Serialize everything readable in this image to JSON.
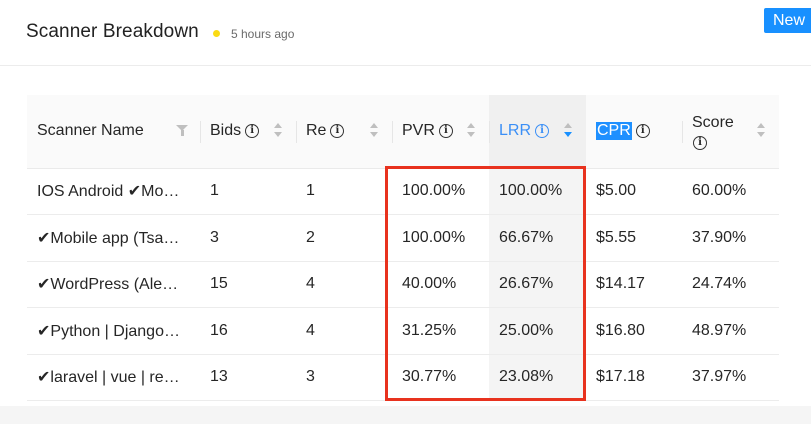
{
  "header": {
    "title": "Scanner Breakdown",
    "timestamp": "5 hours ago",
    "new_button": "New",
    "status_dot_color": "#fadb14"
  },
  "table": {
    "columns": [
      {
        "key": "name",
        "label": "Scanner Name",
        "icon": "filter-icon"
      },
      {
        "key": "bids",
        "label": "Bids",
        "info": true,
        "sort": "none"
      },
      {
        "key": "re",
        "label": "Re",
        "info": true,
        "sort": "none"
      },
      {
        "key": "pvr",
        "label": "PVR",
        "info": true,
        "sort": "none"
      },
      {
        "key": "lrr",
        "label": "LRR",
        "info": true,
        "sort": "descending",
        "active": true
      },
      {
        "key": "cpr",
        "label": "CPR",
        "info": true,
        "selected_text": true
      },
      {
        "key": "score",
        "label": "Score",
        "info": true,
        "sort": "none"
      }
    ],
    "rows": [
      {
        "name": "IOS Android ✔Mo…",
        "bids": "1",
        "re": "1",
        "pvr": "100.00%",
        "lrr": "100.00%",
        "cpr": "$5.00",
        "score": "60.00%"
      },
      {
        "name": "✔Mobile app (Tsa…",
        "bids": "3",
        "re": "2",
        "pvr": "100.00%",
        "lrr": "66.67%",
        "cpr": "$5.55",
        "score": "37.90%"
      },
      {
        "name": "✔WordPress (Ale…",
        "bids": "15",
        "re": "4",
        "pvr": "40.00%",
        "lrr": "26.67%",
        "cpr": "$14.17",
        "score": "24.74%"
      },
      {
        "name": "✔Python | Django…",
        "bids": "16",
        "re": "4",
        "pvr": "31.25%",
        "lrr": "25.00%",
        "cpr": "$16.80",
        "score": "48.97%"
      },
      {
        "name": "✔laravel | vue | re…",
        "bids": "13",
        "re": "3",
        "pvr": "30.77%",
        "lrr": "23.08%",
        "cpr": "$17.18",
        "score": "37.97%"
      }
    ]
  },
  "annotation": {
    "highlight_color": "#e8321e"
  }
}
